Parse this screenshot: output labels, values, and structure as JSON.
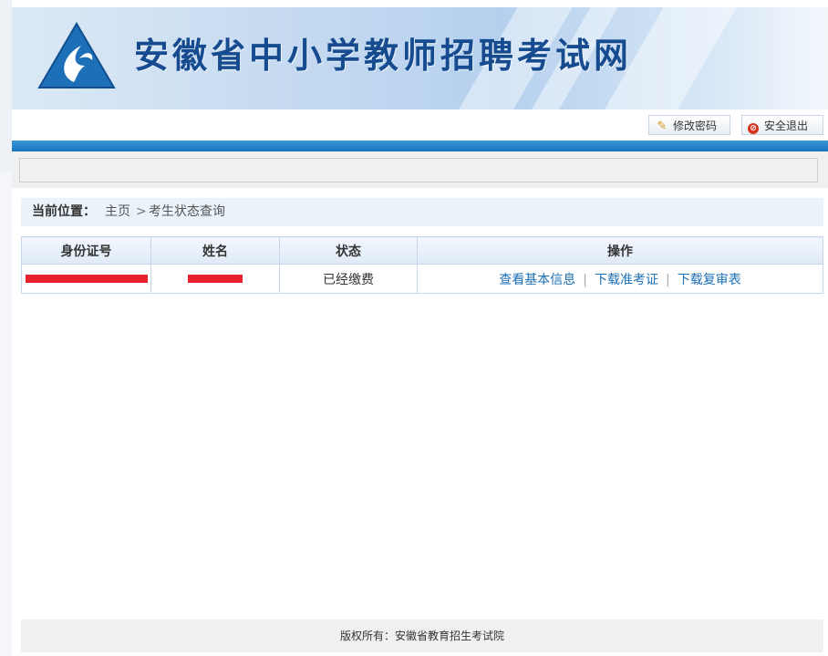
{
  "header": {
    "site_title": "安徽省中小学教师招聘考试网",
    "logo_icon": "teacher-exam-logo-icon"
  },
  "top_actions": {
    "change_password_label": "修改密码",
    "change_password_icon": "pencil-icon",
    "logout_label": "安全退出",
    "logout_icon": "stop-icon"
  },
  "breadcrumb": {
    "label": "当前位置：",
    "home": "主页",
    "separator": ">",
    "current": "考生状态查询"
  },
  "table": {
    "headers": [
      "身份证号",
      "姓名",
      "状态",
      "操作"
    ],
    "rows": [
      {
        "id_number": "[redacted]",
        "name": "[redacted]",
        "status": "已经缴费",
        "actions": [
          "查看基本信息",
          "下载准考证",
          "下载复审表"
        ]
      }
    ]
  },
  "footer": {
    "text": "版权所有：安徽省教育招生考试院"
  },
  "colors": {
    "accent_blue": "#1873bd",
    "link_blue": "#1b6fb5",
    "title_blue": "#174b8f",
    "redaction_red": "#e8222c"
  }
}
